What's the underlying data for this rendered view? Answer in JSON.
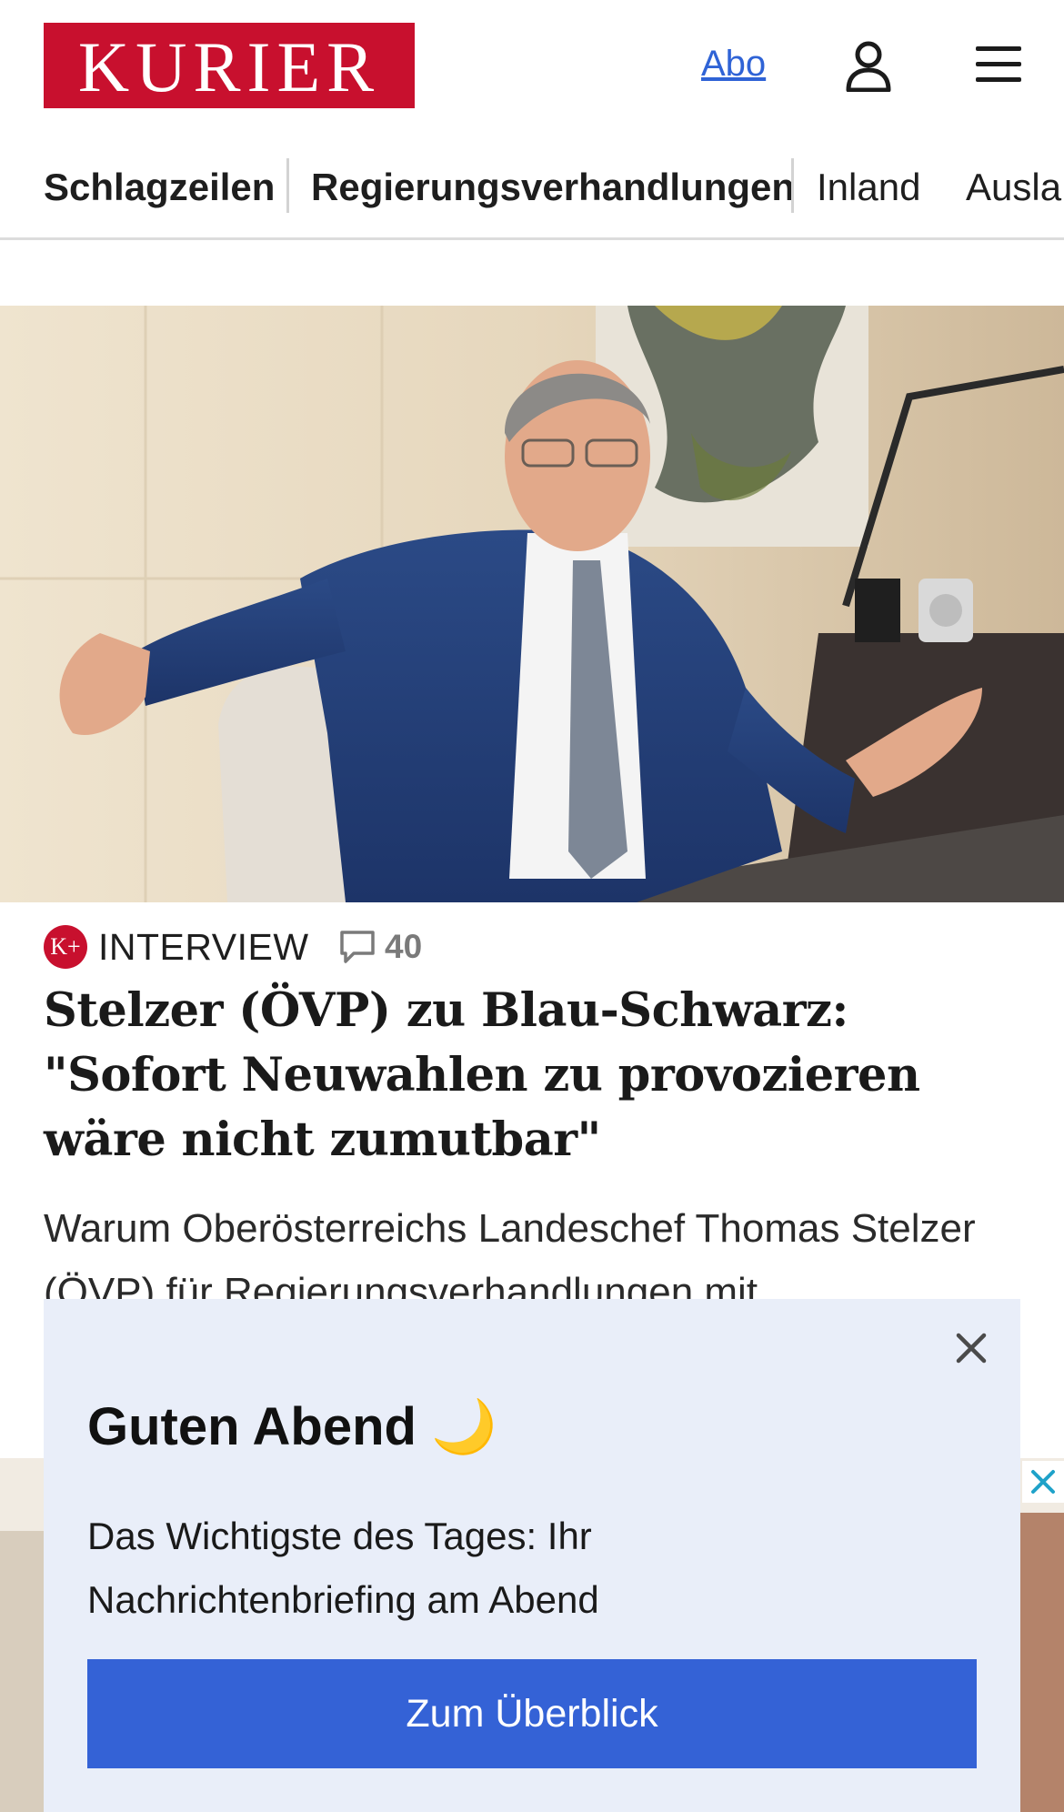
{
  "header": {
    "logo_text": "KURIER",
    "abo_label": "Abo",
    "brand_color": "#c8102e",
    "link_color": "#2f63d6"
  },
  "nav": {
    "items": [
      {
        "label": "Schlagzeilen",
        "bold": true
      },
      {
        "label": "Regierungsverhandlungen",
        "bold": true
      },
      {
        "label": "Inland",
        "bold": false
      },
      {
        "label": "Ausla",
        "bold": false
      }
    ]
  },
  "article": {
    "badge": "K+",
    "rubric": "INTERVIEW",
    "comment_count": "40",
    "headline": "Stelzer (ÖVP) zu Blau-Schwarz: \"Sofort Neuwahlen zu provozieren wäre nicht zumutbar\"",
    "teaser": "Warum Oberösterreichs Landeschef Thomas Stelzer (ÖVP) für Regierungsverhandlungen mit"
  },
  "popup": {
    "title": "Guten Abend 🌙",
    "text": "Das Wichtigste des Tages: Ihr Nachrichtenbriefing am Abend",
    "button_label": "Zum Überblick",
    "button_color": "#3462d6",
    "background": "#e9eef9"
  },
  "icons": {
    "user": "user-icon",
    "menu": "hamburger-menu-icon",
    "comment": "comment-bubble-icon",
    "close": "close-icon"
  }
}
